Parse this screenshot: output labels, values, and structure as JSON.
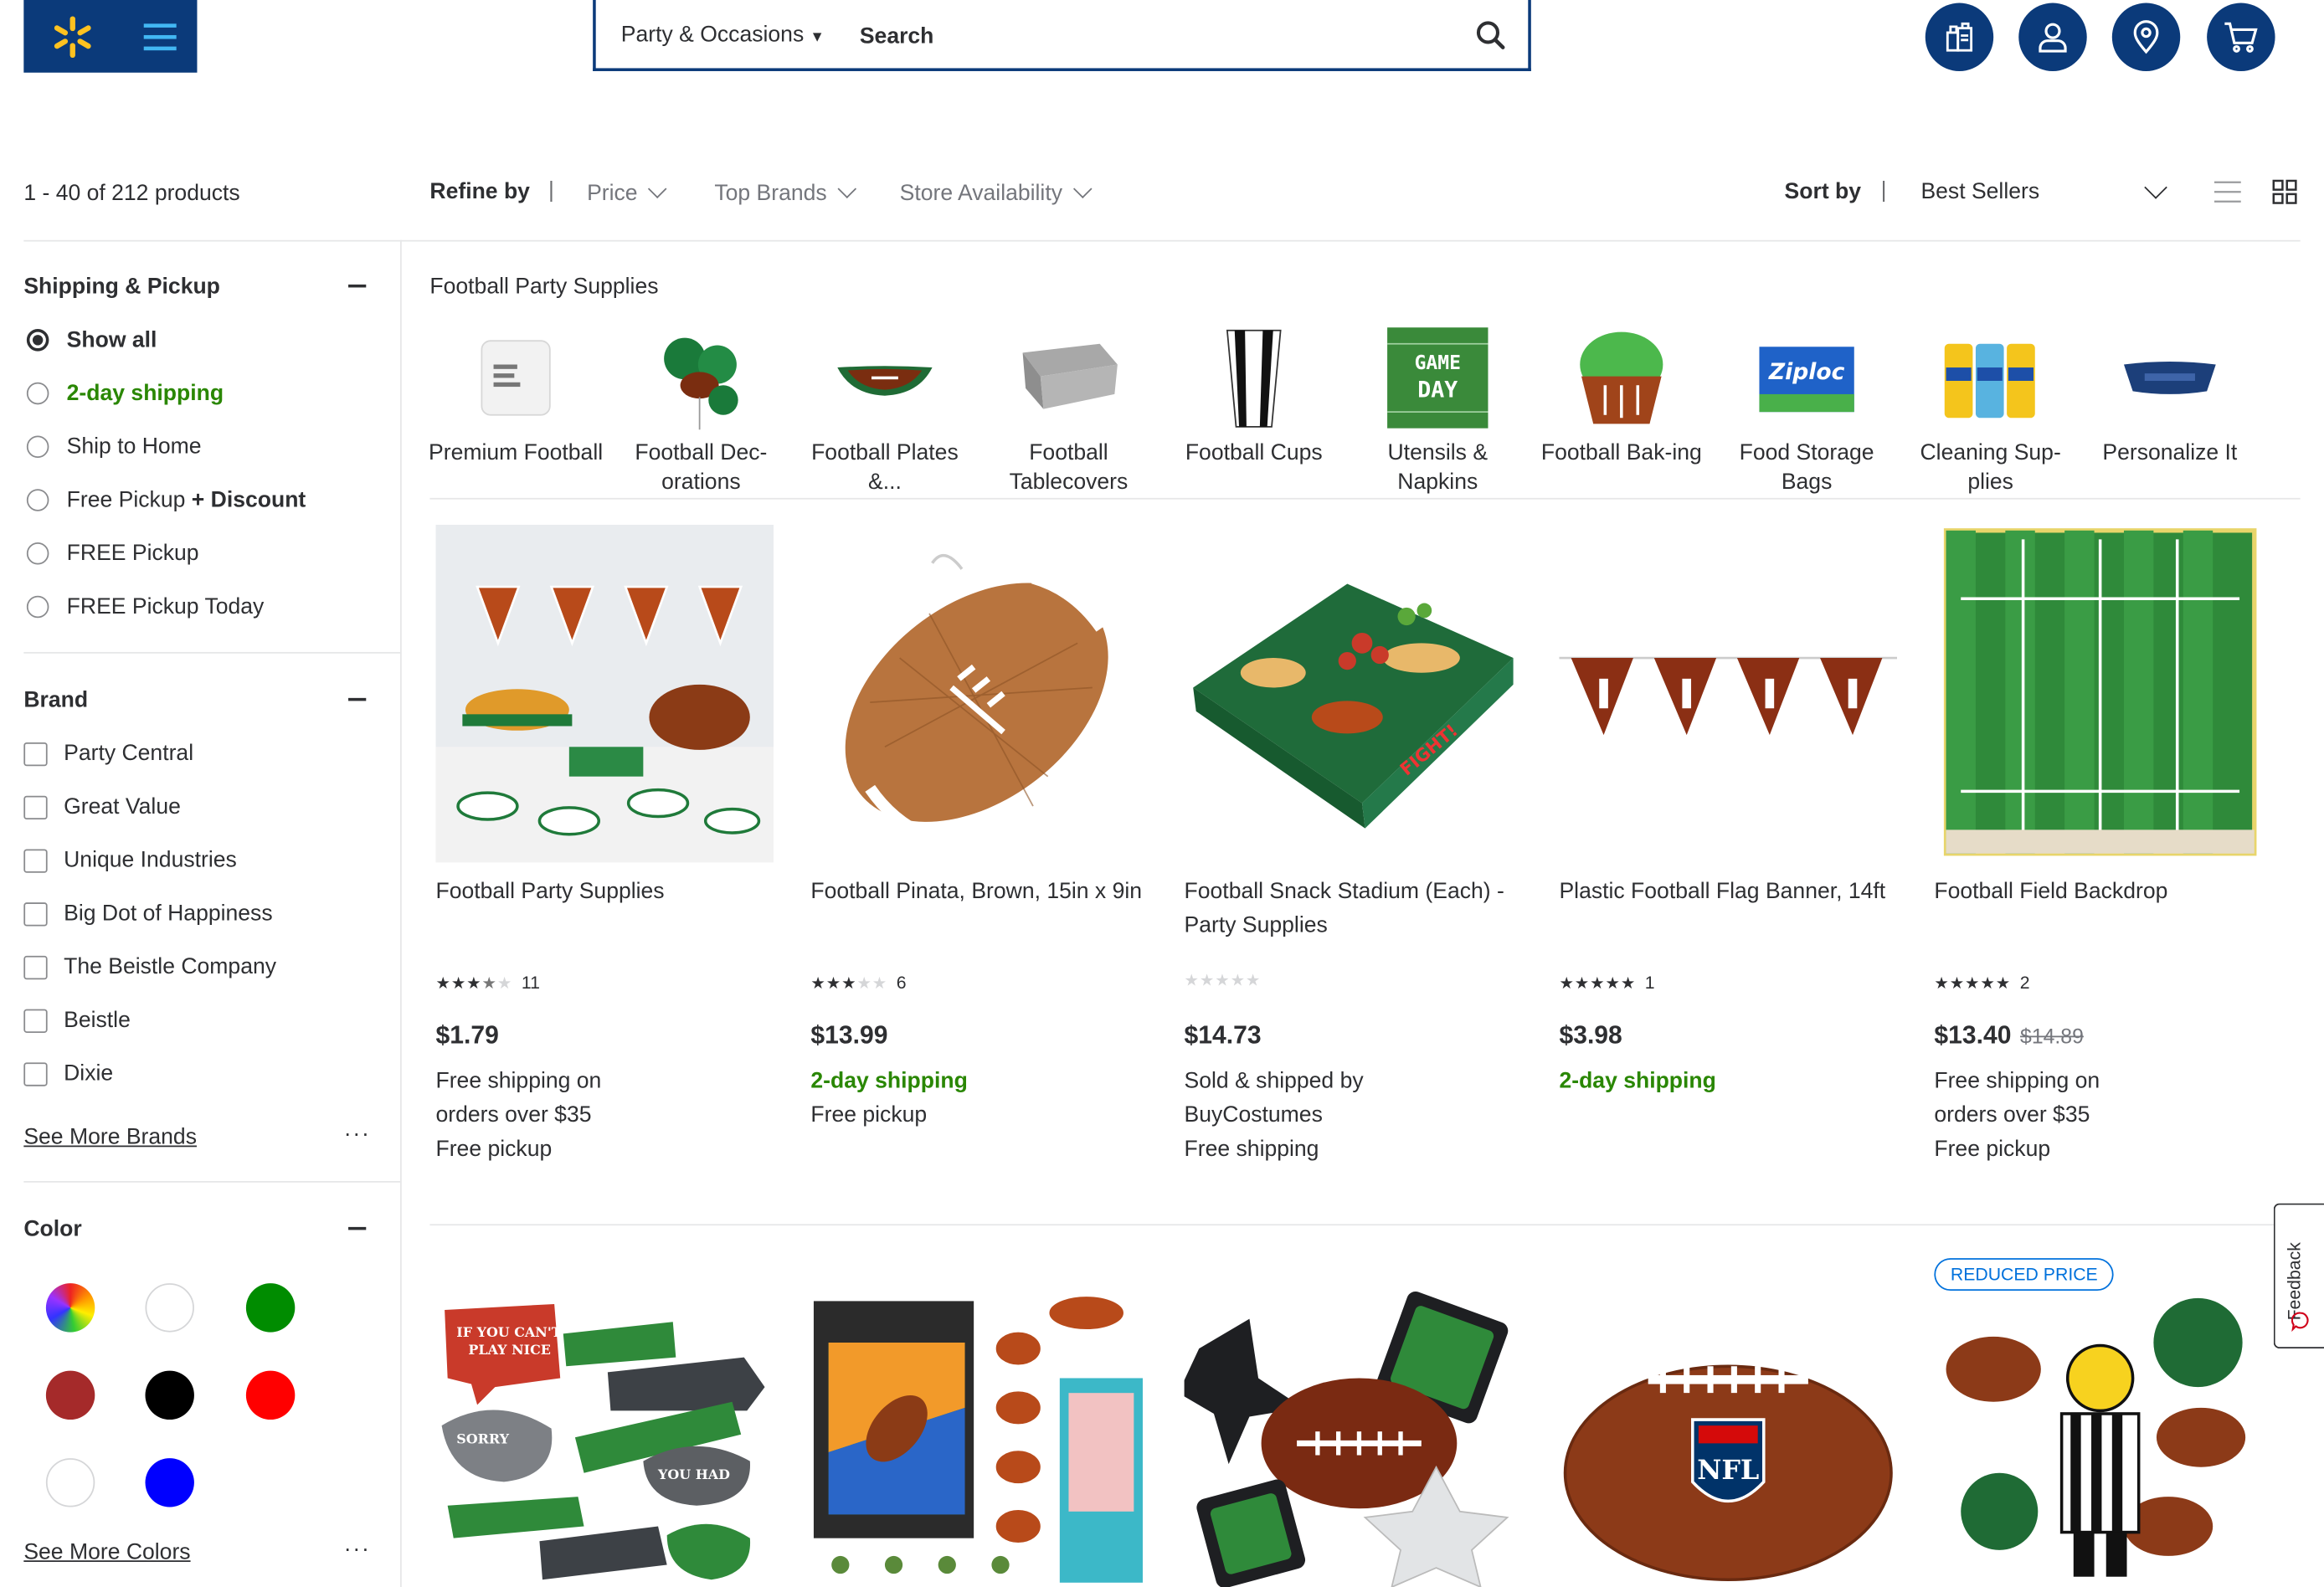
{
  "header": {
    "search": {
      "department": "Party & Occasions",
      "placeholder": "Search",
      "value": ""
    }
  },
  "toolbar": {
    "count": "1 - 40 of 212 products",
    "refine_label": "Refine by",
    "filters": [
      "Price",
      "Top Brands",
      "Store Availability"
    ],
    "sort_label": "Sort by",
    "sort_value": "Best Sellers"
  },
  "sidebar": {
    "shipping": {
      "title": "Shipping & Pickup",
      "options": [
        {
          "label": "Show all",
          "selected": true
        },
        {
          "label": "2-day shipping"
        },
        {
          "label": "Ship to Home"
        },
        {
          "label": "Free Pickup",
          "suffix": "+ Discount"
        },
        {
          "label": "FREE Pickup"
        },
        {
          "label": "FREE Pickup Today"
        }
      ]
    },
    "brand": {
      "title": "Brand",
      "options": [
        "Party Central",
        "Great Value",
        "Unique Industries",
        "Big Dot of Happiness",
        "The Beistle Company",
        "Beistle",
        "Dixie"
      ],
      "see_more": "See More Brands",
      "more_dots": "···"
    },
    "color": {
      "title": "Color",
      "swatches": [
        "multicolor",
        "#ffffff",
        "#008c00",
        "#a52a2a",
        "#000000",
        "#ff0000",
        "#ffffff",
        "#0000ff"
      ],
      "see_more": "See More Colors",
      "more_dots": "···"
    }
  },
  "categories": {
    "title": "Football Party Supplies",
    "items": [
      {
        "label": "Premium Football"
      },
      {
        "label": "Football Dec-orations"
      },
      {
        "label": "Football Plates &..."
      },
      {
        "label": "Football Tablecovers"
      },
      {
        "label": "Football Cups"
      },
      {
        "label": "Utensils & Napkins",
        "thumb_text": "GAME DAY"
      },
      {
        "label": "Football Bak-ing"
      },
      {
        "label": "Food Storage Bags",
        "thumb_text": "Ziploc"
      },
      {
        "label": "Cleaning Sup-plies"
      },
      {
        "label": "Personalize It"
      }
    ]
  },
  "products": [
    {
      "title": "Football Party Supplies",
      "rating": 3.5,
      "reviews": "11",
      "price": "$1.79",
      "ship": [
        "Free shipping on orders over $35",
        "Free pickup"
      ]
    },
    {
      "title": "Football Pinata, Brown, 15in x 9in",
      "rating": 3,
      "reviews": "6",
      "price": "$13.99",
      "ship_green": "2-day shipping",
      "ship": [
        "Free pickup"
      ]
    },
    {
      "title": "Football Snack Stadium (Each) - Party Supplies",
      "rating": 0,
      "reviews": "",
      "price": "$14.73",
      "ship": [
        "Sold & shipped by BuyCostumes",
        "Free shipping"
      ]
    },
    {
      "title": "Plastic Football Flag Banner, 14ft",
      "rating": 5,
      "reviews": "1",
      "price": "$3.98",
      "ship_green": "2-day shipping",
      "ship": []
    },
    {
      "title": "Football Field Backdrop",
      "rating": 5,
      "reviews": "2",
      "price": "$13.40",
      "was": "$14.89",
      "ship": [
        "Free shipping on orders over $35",
        "Free pickup"
      ]
    }
  ],
  "row2": {
    "badge": "REDUCED PRICE"
  },
  "feedback": "Feedback"
}
